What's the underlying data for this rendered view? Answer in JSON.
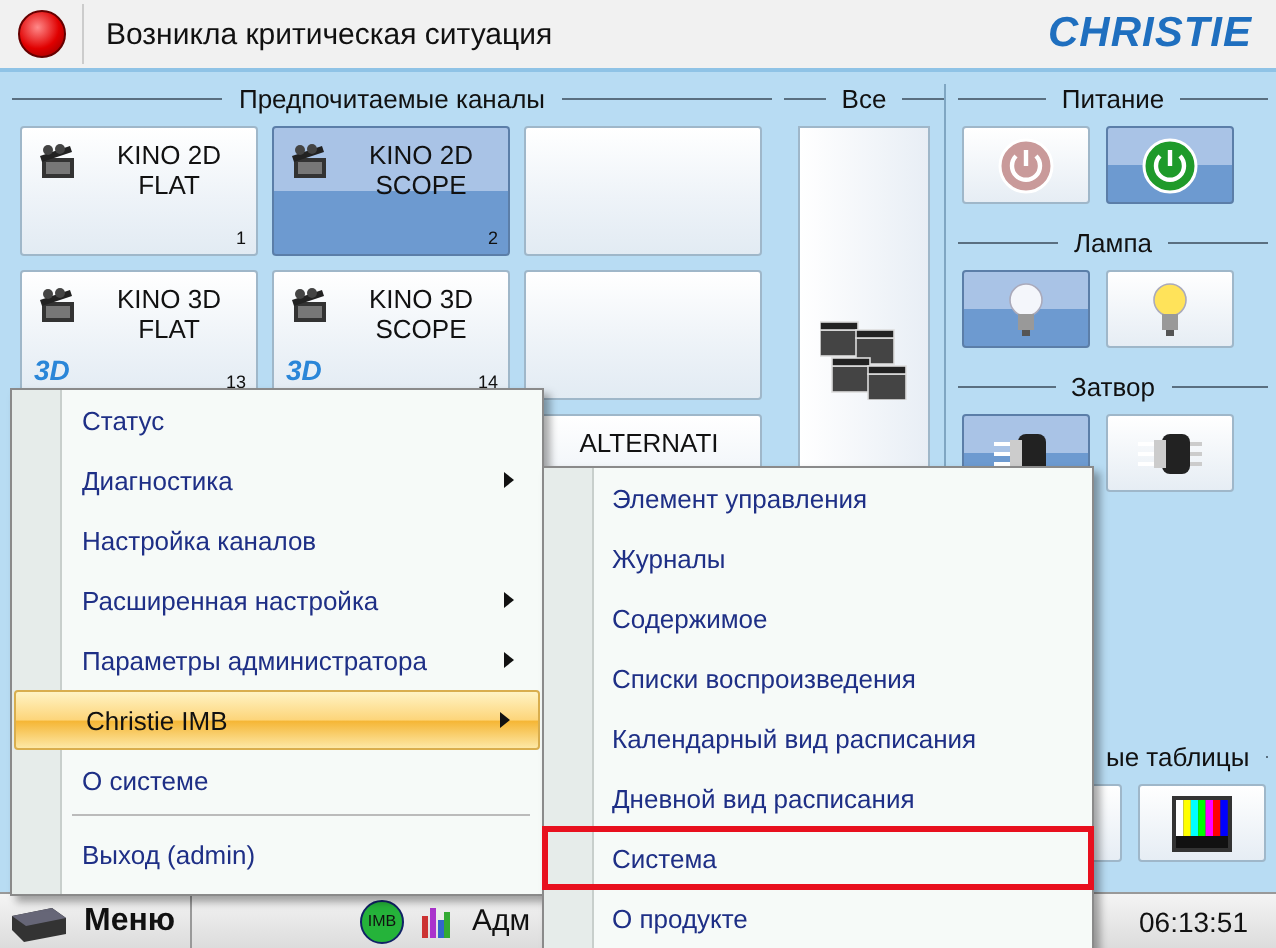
{
  "status": {
    "alert": true,
    "title": "Возникла критическая ситуация"
  },
  "logo": "CHRISTIE",
  "favorites": {
    "title": "Предпочитаемые каналы",
    "channels": [
      {
        "kind": "channel",
        "lines": [
          "KINO 2D",
          "FLAT"
        ],
        "number": "1",
        "selected": false
      },
      {
        "kind": "channel",
        "lines": [
          "KINO 2D",
          "SCOPE"
        ],
        "number": "2",
        "selected": true
      },
      {
        "kind": "empty",
        "selected": false
      },
      {
        "kind": "channel",
        "lines": [
          "KINO 3D",
          "FLAT"
        ],
        "number": "13",
        "badge": "3D",
        "selected": false
      },
      {
        "kind": "channel",
        "lines": [
          "KINO 3D",
          "SCOPE"
        ],
        "number": "14",
        "badge": "3D",
        "selected": false
      },
      {
        "kind": "empty",
        "selected": false
      },
      {
        "kind": "text",
        "lines": [
          "ALTERNATI"
        ],
        "selected": false
      }
    ]
  },
  "all": {
    "title": "Все"
  },
  "panels": [
    {
      "title": "Питание",
      "buttons": [
        {
          "kind": "power-off",
          "selected": false
        },
        {
          "kind": "power-on",
          "selected": true
        }
      ]
    },
    {
      "title": "Лампа",
      "buttons": [
        {
          "kind": "bulb-off",
          "selected": true
        },
        {
          "kind": "bulb-on",
          "selected": false
        }
      ]
    },
    {
      "title": "Затвор",
      "buttons": [
        {
          "kind": "shutter-open",
          "selected": true
        },
        {
          "kind": "shutter-closed",
          "selected": false
        }
      ]
    },
    {
      "title": "ые таблицы",
      "buttons": [
        {
          "kind": "blank",
          "selected": false
        },
        {
          "kind": "test-pattern",
          "selected": false
        }
      ]
    }
  ],
  "menu": {
    "items": [
      {
        "label": "Статус",
        "submenu": false,
        "selected": false,
        "separator_before": false
      },
      {
        "label": "Диагностика",
        "submenu": true,
        "selected": false,
        "separator_before": false
      },
      {
        "label": "Настройка каналов",
        "submenu": false,
        "selected": false,
        "separator_before": false
      },
      {
        "label": "Расширенная настройка",
        "submenu": true,
        "selected": false,
        "separator_before": false
      },
      {
        "label": "Параметры администратора",
        "submenu": true,
        "selected": false,
        "separator_before": false
      },
      {
        "label": "Christie IMB",
        "submenu": true,
        "selected": true,
        "separator_before": false
      },
      {
        "label": "О системе",
        "submenu": false,
        "selected": false,
        "separator_before": false
      },
      {
        "label": "Выход (admin)",
        "submenu": false,
        "selected": false,
        "separator_before": true
      }
    ]
  },
  "submenu": {
    "items": [
      {
        "label": "Элемент управления",
        "outlined": false
      },
      {
        "label": "Журналы",
        "outlined": false
      },
      {
        "label": "Содержимое",
        "outlined": false
      },
      {
        "label": "Списки воспроизведения",
        "outlined": false
      },
      {
        "label": "Календарный вид расписания",
        "outlined": false
      },
      {
        "label": "Дневной вид расписания",
        "outlined": false
      },
      {
        "label": "Система",
        "outlined": true
      },
      {
        "label": "О продукте",
        "outlined": false
      }
    ]
  },
  "taskbar": {
    "menu": "Меню",
    "imb": "IMB",
    "user": "Адм",
    "clock": "06:13:51"
  }
}
